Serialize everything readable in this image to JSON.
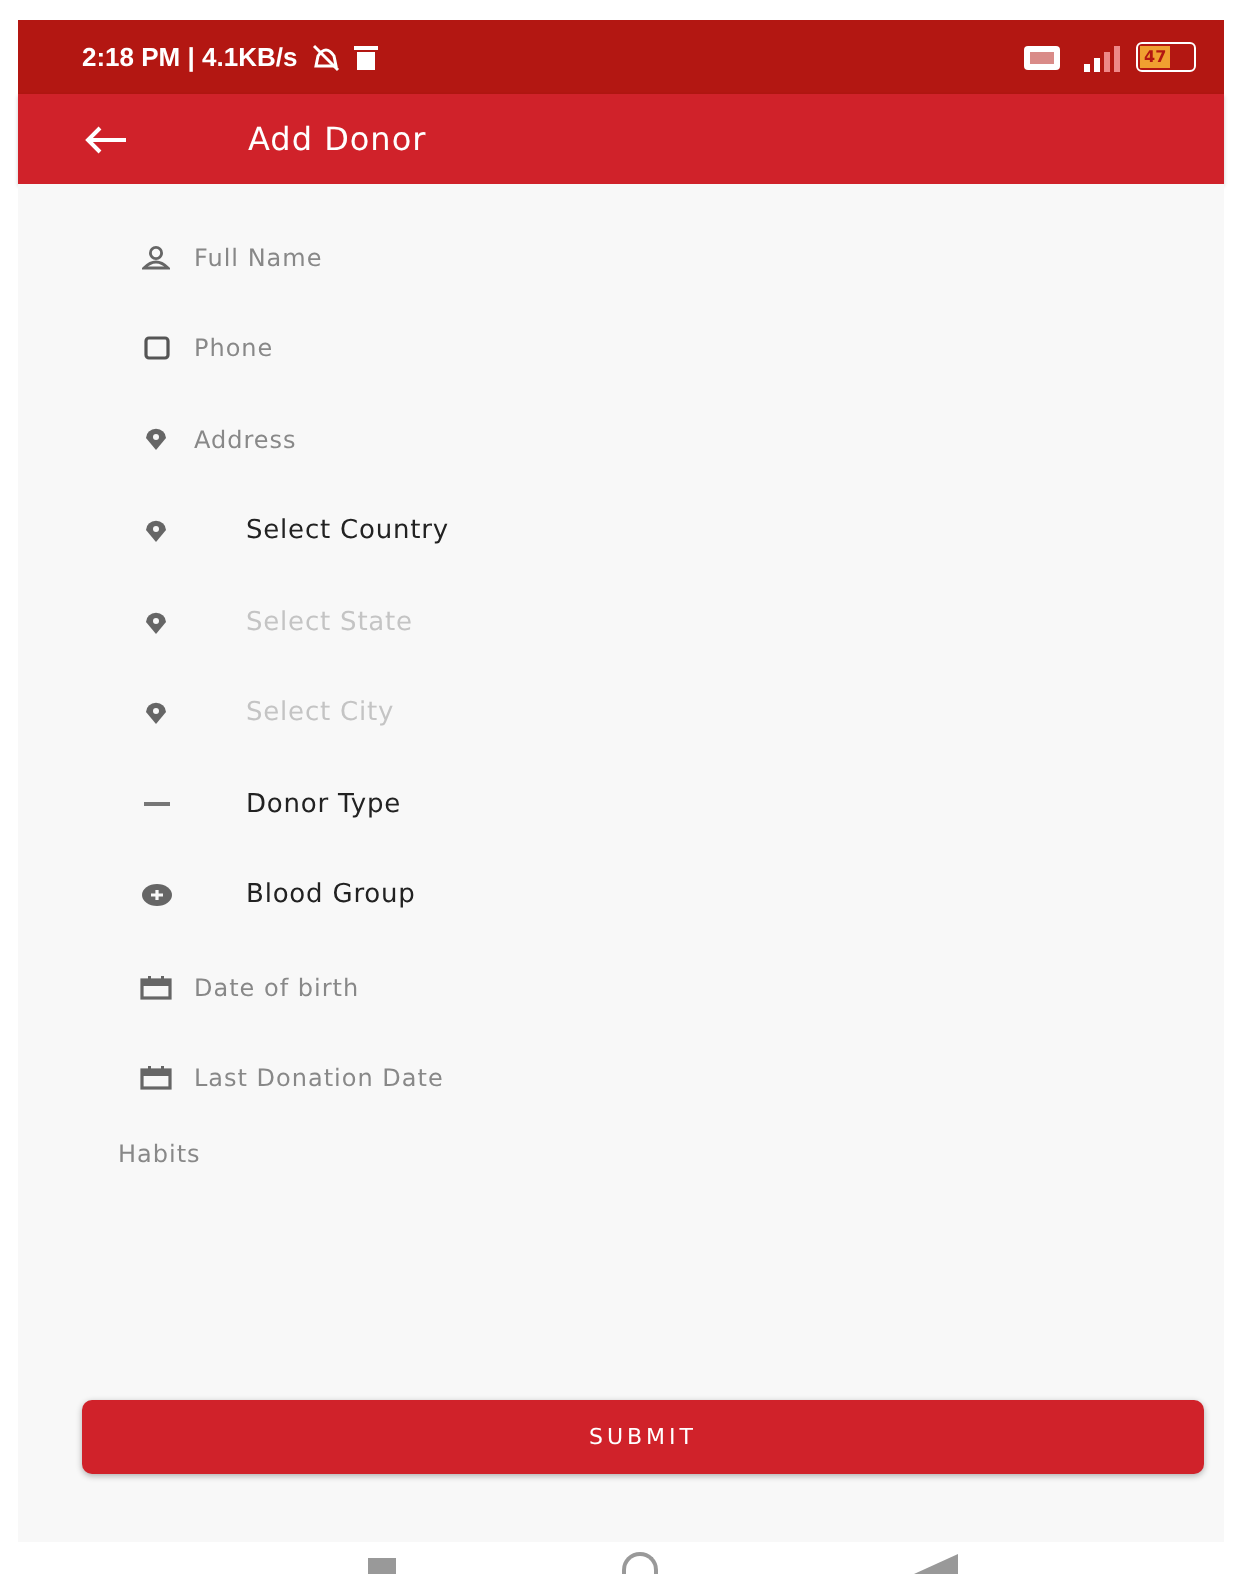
{
  "status_bar": {
    "time": "2:18 PM | 4.1KB/s",
    "battery": "47"
  },
  "app_bar": {
    "title": "Add Donor"
  },
  "fields": [
    {
      "kind": "text",
      "placeholder": "Full Name"
    },
    {
      "kind": "text",
      "placeholder": "Phone"
    },
    {
      "kind": "text",
      "placeholder": "Address"
    },
    {
      "kind": "select",
      "value": "Select Country",
      "disabled": false
    },
    {
      "kind": "select",
      "value": "Select State",
      "disabled": true
    },
    {
      "kind": "select",
      "value": "Select City",
      "disabled": true
    },
    {
      "kind": "select",
      "value": "Donor Type",
      "disabled": false
    },
    {
      "kind": "select",
      "value": "Blood Group",
      "disabled": false
    },
    {
      "kind": "text",
      "placeholder": "Date of birth"
    },
    {
      "kind": "text",
      "placeholder": "Last Donation Date"
    },
    {
      "kind": "textarea",
      "placeholder": "Habits"
    }
  ],
  "submit_button": "SUBMIT"
}
